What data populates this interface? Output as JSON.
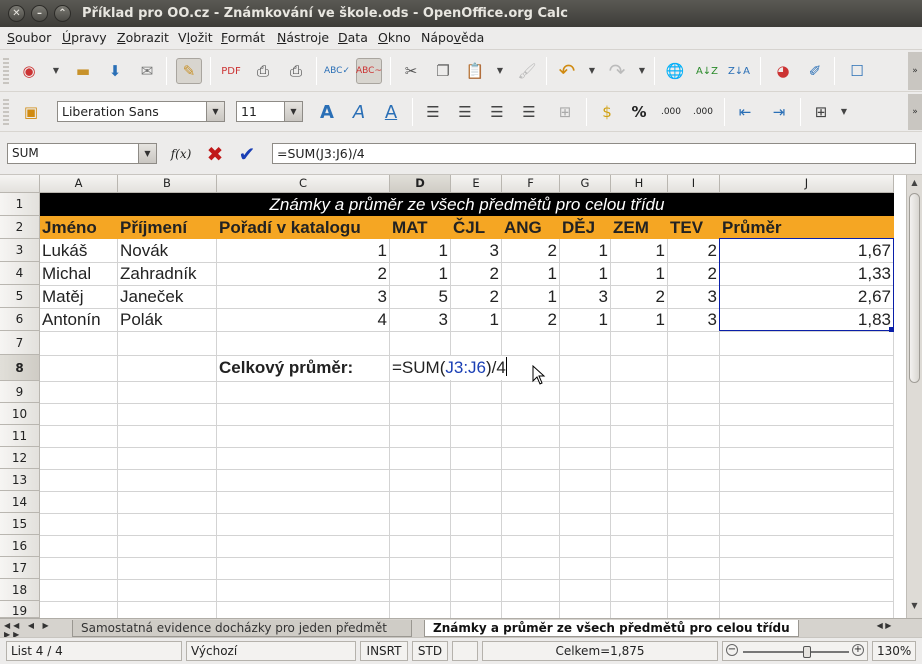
{
  "window": {
    "title": "Příklad pro OO.cz - Známkování ve škole.ods - OpenOffice.org Calc"
  },
  "menu": [
    "Soubor",
    "Úpravy",
    "Zobrazit",
    "Vložit",
    "Formát",
    "Nástroje",
    "Data",
    "Okno",
    "Nápověda"
  ],
  "menu_mnemonic": [
    "S",
    "Ú",
    "Z",
    "l",
    "F",
    "N",
    "D",
    "O",
    "v"
  ],
  "format_toolbar": {
    "font_name": "Liberation Sans",
    "font_size": "11"
  },
  "formula_bar": {
    "name_box": "SUM",
    "formula": "=SUM(J3:J6)/4",
    "function_label": "f(x)"
  },
  "columns": [
    "A",
    "B",
    "C",
    "D",
    "E",
    "F",
    "G",
    "H",
    "I",
    "J"
  ],
  "rows": [
    "1",
    "2",
    "3",
    "4",
    "5",
    "6",
    "7",
    "8",
    "9",
    "10",
    "11",
    "12",
    "13",
    "14",
    "15",
    "16",
    "17",
    "18",
    "19"
  ],
  "sheet": {
    "title": "Známky a průměr ze všech předmětů pro celou třídu",
    "headers": [
      "Jméno",
      "Příjmení",
      "Pořadí v katalogu",
      "MAT",
      "ČJL",
      "ANG",
      "DĚJ",
      "ZEM",
      "TEV",
      "Průměr"
    ],
    "data_rows": [
      [
        "Lukáš",
        "Novák",
        "1",
        "1",
        "3",
        "2",
        "1",
        "1",
        "2",
        "1,67"
      ],
      [
        "Michal",
        "Zahradník",
        "2",
        "1",
        "2",
        "1",
        "1",
        "1",
        "2",
        "1,33"
      ],
      [
        "Matěj",
        "Janeček",
        "3",
        "5",
        "2",
        "1",
        "3",
        "2",
        "3",
        "2,67"
      ],
      [
        "Antonín",
        "Polák",
        "4",
        "3",
        "1",
        "2",
        "1",
        "1",
        "3",
        "1,83"
      ]
    ],
    "total_label": "Celkový průměr:",
    "edit_formula": {
      "prefix": "=SUM(",
      "ref": "J3:J6",
      "suffix": ")/4"
    }
  },
  "sheet_tabs": [
    "Samostatná evidence docházky pro jeden předmět",
    "Známky a průměr ze všech předmětů pro celou třídu"
  ],
  "status": {
    "sheet": "List 4 / 4",
    "style": "Výchozí",
    "mode": "INSRT",
    "selection": "STD",
    "sum": "Celkem=1,875",
    "zoom": "130%"
  },
  "zoom_level": 0.6,
  "colors": {
    "title_band": "#000000",
    "header_band": "#f5a623",
    "header_text": "#1a1a1a",
    "ref_blue": "#1a3fb5",
    "selection": "#0a1fa8"
  }
}
